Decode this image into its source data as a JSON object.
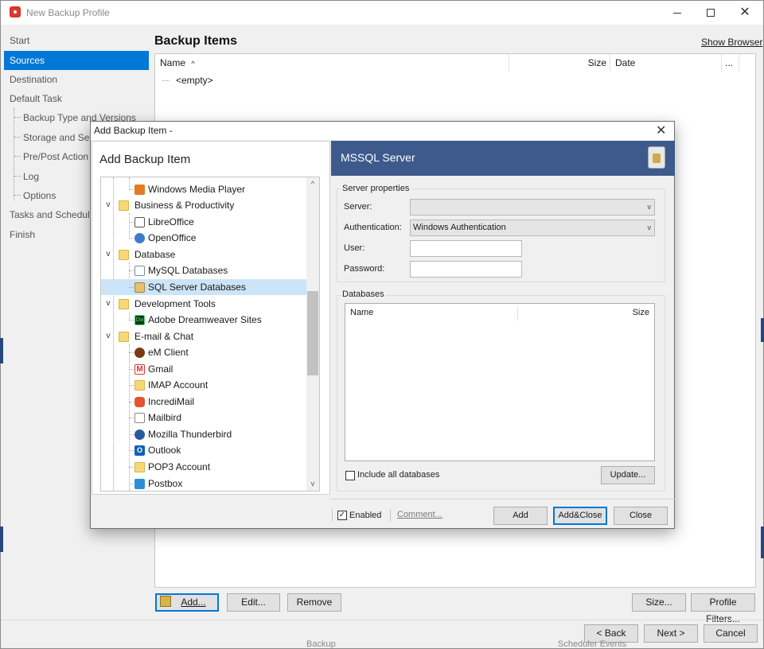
{
  "window": {
    "title": "New Backup Profile"
  },
  "nav": {
    "items": [
      {
        "label": "Start"
      },
      {
        "label": "Sources"
      },
      {
        "label": "Destination"
      },
      {
        "label": "Default Task"
      },
      {
        "label": "Backup Type and Versions"
      },
      {
        "label": "Storage and Se"
      },
      {
        "label": "Pre/Post Action"
      },
      {
        "label": "Log"
      },
      {
        "label": "Options"
      },
      {
        "label": "Tasks and Schedule"
      },
      {
        "label": "Finish"
      }
    ]
  },
  "main": {
    "title": "Backup Items",
    "show_browser": "Show Browser",
    "columns": {
      "name": "Name",
      "size": "Size",
      "date": "Date",
      "more": "..."
    },
    "empty_text": "<empty>",
    "buttons": {
      "add": "Add...",
      "edit": "Edit...",
      "remove": "Remove",
      "size": "Size...",
      "profile_filters": "Profile Filters..."
    }
  },
  "footer": {
    "back": "< Back",
    "next": "Next >",
    "cancel": "Cancel"
  },
  "dialog": {
    "title": "Add Backup Item -",
    "left_title": "Add Backup Item",
    "tree": [
      {
        "label": "Windows Media Player",
        "icon": "windows-media-player-icon"
      },
      {
        "label": "Business & Productivity",
        "icon": "folder-icon"
      },
      {
        "label": "LibreOffice",
        "icon": "document-icon"
      },
      {
        "label": "OpenOffice",
        "icon": "openoffice-icon"
      },
      {
        "label": "Database",
        "icon": "folder-icon"
      },
      {
        "label": "MySQL Databases",
        "icon": "mysql-icon"
      },
      {
        "label": "SQL Server Databases",
        "icon": "sql-server-icon"
      },
      {
        "label": "Development Tools",
        "icon": "folder-icon"
      },
      {
        "label": "Adobe Dreamweaver Sites",
        "icon": "dreamweaver-icon"
      },
      {
        "label": "E-mail & Chat",
        "icon": "folder-icon"
      },
      {
        "label": "eM Client",
        "icon": "em-client-icon"
      },
      {
        "label": "Gmail",
        "icon": "gmail-icon"
      },
      {
        "label": "IMAP Account",
        "icon": "mail-folder-icon"
      },
      {
        "label": "IncrediMail",
        "icon": "incredimail-icon"
      },
      {
        "label": "Mailbird",
        "icon": "mailbird-icon"
      },
      {
        "label": "Mozilla Thunderbird",
        "icon": "thunderbird-icon"
      },
      {
        "label": "Outlook",
        "icon": "outlook-icon"
      },
      {
        "label": "POP3 Account",
        "icon": "mail-folder-icon"
      },
      {
        "label": "Postbox",
        "icon": "postbox-icon"
      }
    ],
    "right_title": "MSSQL Server",
    "server_group": "Server properties",
    "server_label": "Server:",
    "server_value": "",
    "auth_label": "Authentication:",
    "auth_value": "Windows Authentication",
    "user_label": "User:",
    "user_value": "",
    "password_label": "Password:",
    "password_value": "",
    "databases_group": "Databases",
    "db_columns": {
      "name": "Name",
      "size": "Size"
    },
    "include_all": "Include all databases",
    "update": "Update...",
    "enabled": "Enabled",
    "enabled_checked": true,
    "comment": "Comment...",
    "add": "Add",
    "add_close": "Add&Close",
    "close": "Close"
  },
  "colors": {
    "accent": "#0078d7",
    "header": "#3e5a8c",
    "selection": "#cce4f7"
  },
  "background_text": {
    "left": "Backup",
    "right": "Scheduler Events"
  }
}
